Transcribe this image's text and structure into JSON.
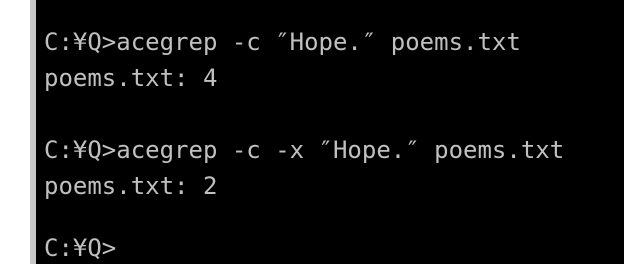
{
  "terminal": {
    "lines": [
      "C:¥Q>acegrep -c ″Hope.″ poems.txt",
      "poems.txt: 4",
      "",
      "C:¥Q>acegrep -c -x ″Hope.″ poems.txt",
      "poems.txt: 2",
      "",
      "C:¥Q>"
    ]
  },
  "colors": {
    "background": "#000000",
    "text": "#c0c0c0",
    "frame": "#c8c8c8"
  }
}
